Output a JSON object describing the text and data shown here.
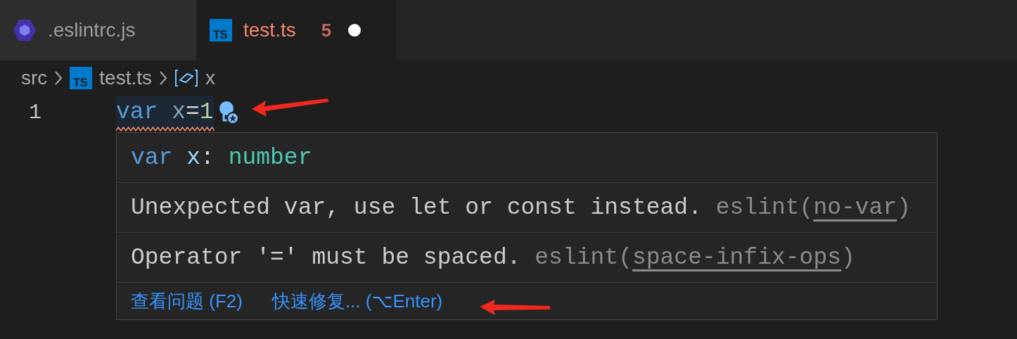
{
  "tabs": [
    {
      "label": ".eslintrc.js",
      "kind": "eslint",
      "selected": false,
      "has_errors": false
    },
    {
      "label": "test.ts",
      "kind": "ts",
      "icon_text": "TS",
      "selected": true,
      "has_errors": true,
      "problems": "5",
      "dirty": true
    }
  ],
  "breadcrumb": [
    {
      "label": "src",
      "kind": "folder"
    },
    {
      "label": "test.ts",
      "kind": "ts",
      "icon_text": "TS"
    },
    {
      "label": "x",
      "kind": "variable"
    }
  ],
  "editor": {
    "line_number": "1",
    "tokens": [
      {
        "text": "var",
        "kind": "keyword"
      },
      {
        "kind": "space"
      },
      {
        "text": "x",
        "kind": "variable"
      },
      {
        "text": "=",
        "kind": "operator"
      },
      {
        "text": "1",
        "kind": "number"
      }
    ],
    "squiggle": true,
    "lightbulb": true
  },
  "hover": {
    "signature": [
      {
        "text": "var",
        "kind": "keyword"
      },
      {
        "kind": "space"
      },
      {
        "text": "x",
        "kind": "variable"
      },
      {
        "text": ":",
        "kind": "plain"
      },
      {
        "kind": "space"
      },
      {
        "text": "number",
        "kind": "type"
      }
    ],
    "messages": [
      {
        "text": "Unexpected var, use let or const instead.",
        "source": "eslint(",
        "rule": "no-var",
        "close": ")"
      },
      {
        "text": "Operator '=' must be spaced.",
        "source": "eslint(",
        "rule": "space-infix-ops",
        "close": ")"
      }
    ],
    "actions": [
      "查看问题 (F2)",
      "快速修复... (⌥Enter)"
    ]
  }
}
